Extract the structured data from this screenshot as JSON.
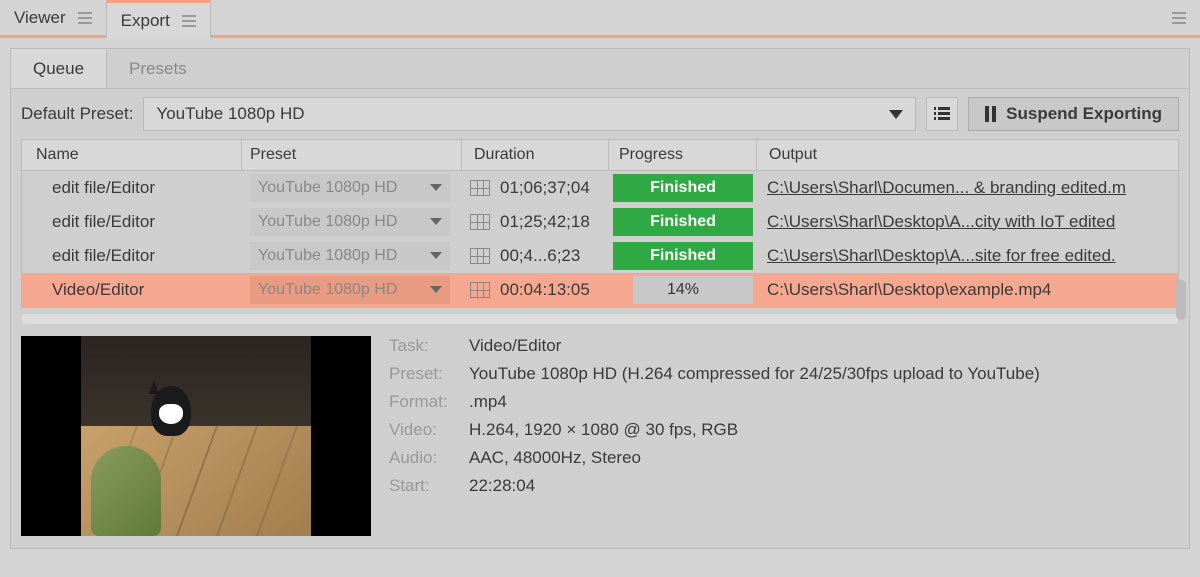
{
  "topTabs": [
    {
      "label": "Viewer",
      "active": false
    },
    {
      "label": "Export",
      "active": true
    }
  ],
  "subTabs": [
    {
      "label": "Queue",
      "active": true
    },
    {
      "label": "Presets",
      "active": false
    }
  ],
  "defaultPresetLabel": "Default Preset:",
  "defaultPresetValue": "YouTube 1080p HD",
  "suspendBtn": "Suspend Exporting",
  "columns": {
    "name": "Name",
    "preset": "Preset",
    "duration": "Duration",
    "progress": "Progress",
    "output": "Output"
  },
  "rows": [
    {
      "name": "edit file/Editor",
      "preset": "YouTube 1080p HD",
      "duration": "01;06;37;04",
      "progress": "Finished",
      "finished": true,
      "output": "C:\\Users\\Sharl\\Documen... & branding edited.m",
      "selected": false
    },
    {
      "name": "edit file/Editor",
      "preset": "YouTube 1080p HD",
      "duration": "01;25;42;18",
      "progress": "Finished",
      "finished": true,
      "output": "C:\\Users\\Sharl\\Desktop\\A...city with IoT edited",
      "selected": false
    },
    {
      "name": "edit file/Editor",
      "preset": "YouTube 1080p HD",
      "duration": "00;4...6;23",
      "progress": "Finished",
      "finished": true,
      "output": "C:\\Users\\Sharl\\Desktop\\A...site for free edited.",
      "selected": false
    },
    {
      "name": "Video/Editor",
      "preset": "YouTube 1080p HD",
      "duration": "00:04:13:05",
      "progress": "14%",
      "finished": false,
      "output": "C:\\Users\\Sharl\\Desktop\\example.mp4",
      "selected": true
    }
  ],
  "details": {
    "taskLabel": "Task:",
    "taskValue": "Video/Editor",
    "presetLabel": "Preset:",
    "presetValue": "YouTube 1080p HD (H.264 compressed for 24/25/30fps upload to YouTube)",
    "formatLabel": "Format:",
    "formatValue": ".mp4",
    "videoLabel": "Video:",
    "videoValue": "H.264, 1920 × 1080 @ 30 fps, RGB",
    "audioLabel": "Audio:",
    "audioValue": "AAC, 48000Hz, Stereo",
    "startLabel": "Start:",
    "startValue": "22:28:04"
  }
}
